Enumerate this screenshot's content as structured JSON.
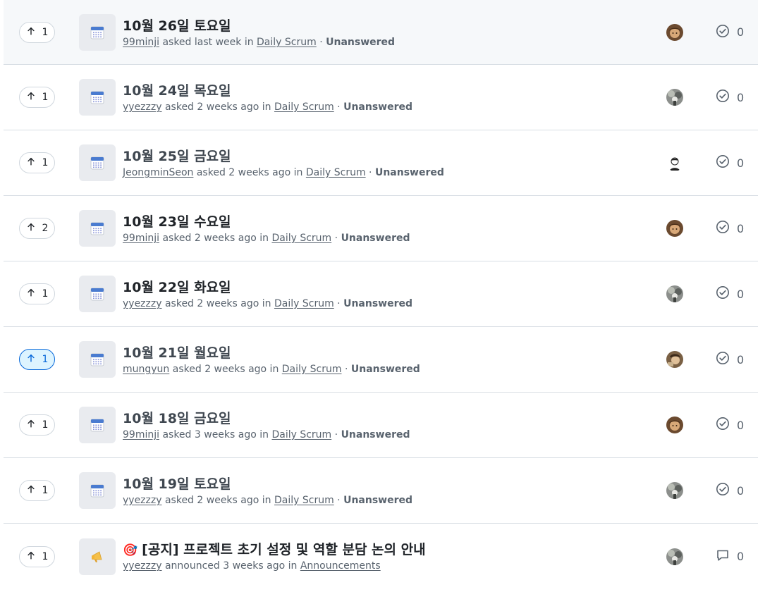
{
  "discussions": [
    {
      "votes": "1",
      "vote_active": false,
      "icon": "calendar-icon",
      "title": "10월 26일 토요일",
      "title_read": false,
      "author": "99minji",
      "meta_text": " asked last week in ",
      "category": "Daily Scrum",
      "separator": " · ",
      "status": "Unanswered",
      "avatar": "avatar-brown",
      "count_icon": "check-circle-icon",
      "count": "0"
    },
    {
      "votes": "1",
      "vote_active": false,
      "icon": "calendar-icon",
      "title": "10월 24일 목요일",
      "title_read": true,
      "author": "yyezzzy",
      "meta_text": " asked 2 weeks ago in ",
      "category": "Daily Scrum",
      "separator": " · ",
      "status": "Unanswered",
      "avatar": "avatar-gray",
      "count_icon": "check-circle-icon",
      "count": "0"
    },
    {
      "votes": "1",
      "vote_active": false,
      "icon": "calendar-icon",
      "title": "10월 25일 금요일",
      "title_read": true,
      "author": "JeongminSeon",
      "meta_text": " asked 2 weeks ago in ",
      "category": "Daily Scrum",
      "separator": " · ",
      "status": "Unanswered",
      "avatar": "avatar-white",
      "count_icon": "check-circle-icon",
      "count": "0"
    },
    {
      "votes": "2",
      "vote_active": false,
      "icon": "calendar-icon",
      "title": "10월 23일 수요일",
      "title_read": false,
      "author": "99minji",
      "meta_text": " asked 2 weeks ago in ",
      "category": "Daily Scrum",
      "separator": " · ",
      "status": "Unanswered",
      "avatar": "avatar-brown",
      "count_icon": "check-circle-icon",
      "count": "0"
    },
    {
      "votes": "1",
      "vote_active": false,
      "icon": "calendar-icon",
      "title": "10월 22일 화요일",
      "title_read": false,
      "author": "yyezzzy",
      "meta_text": " asked 2 weeks ago in ",
      "category": "Daily Scrum",
      "separator": " · ",
      "status": "Unanswered",
      "avatar": "avatar-gray",
      "count_icon": "check-circle-icon",
      "count": "0"
    },
    {
      "votes": "1",
      "vote_active": true,
      "icon": "calendar-icon",
      "title": "10월 21일 월요일",
      "title_read": true,
      "author": "mungyun",
      "meta_text": " asked 2 weeks ago in ",
      "category": "Daily Scrum",
      "separator": " · ",
      "status": "Unanswered",
      "avatar": "avatar-tan",
      "count_icon": "check-circle-icon",
      "count": "0"
    },
    {
      "votes": "1",
      "vote_active": false,
      "icon": "calendar-icon",
      "title": "10월 18일 금요일",
      "title_read": true,
      "author": "99minji",
      "meta_text": " asked 3 weeks ago in ",
      "category": "Daily Scrum",
      "separator": " · ",
      "status": "Unanswered",
      "avatar": "avatar-brown",
      "count_icon": "check-circle-icon",
      "count": "0"
    },
    {
      "votes": "1",
      "vote_active": false,
      "icon": "calendar-icon",
      "title": "10월 19일 토요일",
      "title_read": true,
      "author": "yyezzzy",
      "meta_text": " asked 2 weeks ago in ",
      "category": "Daily Scrum",
      "separator": " · ",
      "status": "Unanswered",
      "avatar": "avatar-gray",
      "count_icon": "check-circle-icon",
      "count": "0"
    },
    {
      "votes": "1",
      "vote_active": false,
      "icon": "megaphone-icon",
      "title_emoji": "🎯",
      "title": "[공지] 프로젝트 초기 설정 및 역할 분담 논의 안내",
      "title_read": false,
      "author": "yyezzzy",
      "meta_text": " announced 3 weeks ago in ",
      "category": "Announcements",
      "separator": "",
      "status": "",
      "avatar": "avatar-gray",
      "count_icon": "comment-icon",
      "count": "0"
    }
  ],
  "colors": {
    "accent": "#0969da",
    "muted": "#59636e",
    "border": "#d8dee4",
    "calendar_blue": "#4a7bd0"
  }
}
